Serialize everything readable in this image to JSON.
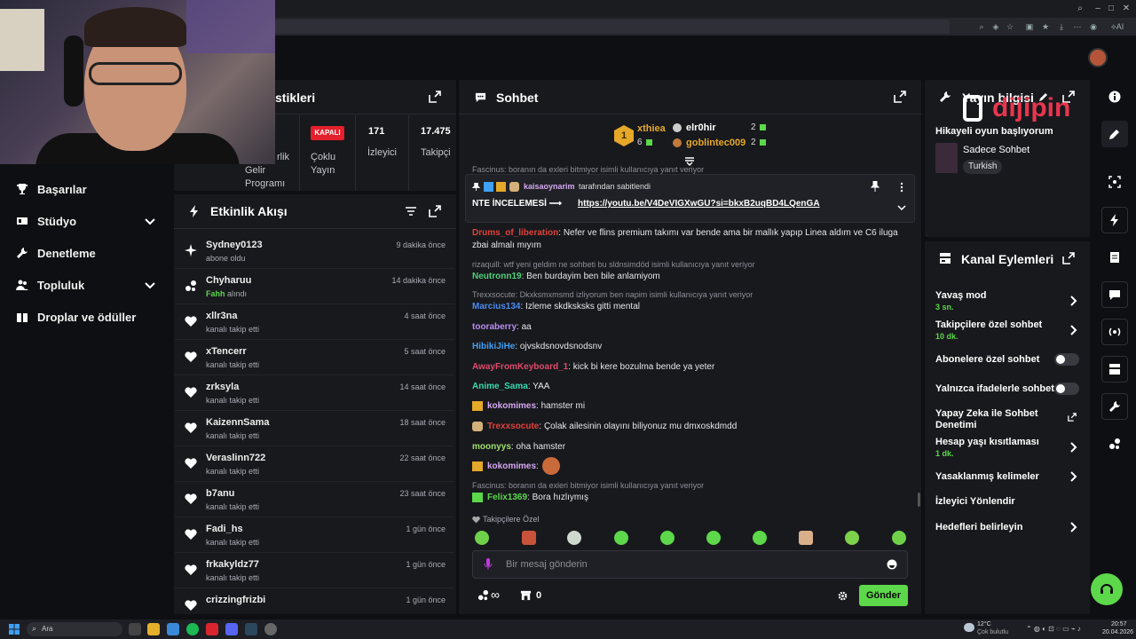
{
  "colors": {
    "accent": "#5cd84a",
    "live_off": "#e3202b",
    "link": "#ffffff"
  },
  "browser": {
    "search_placeholder": "Ara"
  },
  "nav": {
    "items": [
      {
        "label": "Başarılar",
        "icon": "trophy-icon"
      },
      {
        "label": "Stüdyo",
        "icon": "studio-icon",
        "expandable": true
      },
      {
        "label": "Denetleme",
        "icon": "wrench-icon"
      },
      {
        "label": "Topluluk",
        "icon": "community-icon",
        "expandable": true
      },
      {
        "label": "Droplar ve ödüller",
        "icon": "gift-icon"
      }
    ]
  },
  "stats": {
    "title_fragment": "stikleri",
    "col1": "rlik",
    "col1b": "Gelir",
    "col1c": "Programı",
    "badge": "KAPALI",
    "col2a": "Çoklu",
    "col2b": "Yayın",
    "viewers_value": "171",
    "viewers_label": "İzleyici",
    "followers_value": "17.475",
    "followers_label": "Takipçi"
  },
  "feed": {
    "title": "Etkinlik Akışı",
    "rows": [
      {
        "name": "Sydney0123",
        "sub": "abone oldu",
        "time": "9 dakika önce",
        "icon": "sparkle-icon"
      },
      {
        "name": "Chyharuu",
        "sub_accent": "Fahh",
        "sub": "alındı",
        "time": "14 dakika önce",
        "icon": "points-icon"
      },
      {
        "name": "xllr3na",
        "sub": "kanalı takip etti",
        "time": "4 saat önce",
        "icon": "heart-icon"
      },
      {
        "name": "xTencerr",
        "sub": "kanalı takip etti",
        "time": "5 saat önce",
        "icon": "heart-icon"
      },
      {
        "name": "zrksyla",
        "sub": "kanalı takip etti",
        "time": "14 saat önce",
        "icon": "heart-icon"
      },
      {
        "name": "KaizennSama",
        "sub": "kanalı takip etti",
        "time": "18 saat önce",
        "icon": "heart-icon"
      },
      {
        "name": "Veraslinn722",
        "sub": "kanalı takip etti",
        "time": "22 saat önce",
        "icon": "heart-icon"
      },
      {
        "name": "b7anu",
        "sub": "kanalı takip etti",
        "time": "23 saat önce",
        "icon": "heart-icon"
      },
      {
        "name": "Fadi_hs",
        "sub": "kanalı takip etti",
        "time": "1 gün önce",
        "icon": "heart-icon"
      },
      {
        "name": "frkakyldz77",
        "sub": "kanalı takip etti",
        "time": "1 gün önce",
        "icon": "heart-icon"
      },
      {
        "name": "crizzingfrizbi",
        "sub": "kanalı takip etti",
        "time": "1 gün önce",
        "icon": "heart-icon"
      }
    ]
  },
  "chat": {
    "title": "Sohbet",
    "leader1": {
      "rank": "1",
      "name": "xthiea",
      "count": "6"
    },
    "leader2": {
      "name": "elr0hir",
      "count": "2"
    },
    "leader3": {
      "name": "goblintec009",
      "count": "2"
    },
    "pinned": {
      "pinned_by": "kaisaoynarim",
      "pinned_suffix": "tarafından sabitlendi",
      "text_prefix": "NTE İNCELEMESİ ⟶",
      "link": "https://youtu.be/V4DeVIGXwGU?si=bkxB2uqBD4LQenGA"
    },
    "messages": [
      {
        "user": "Drums_of_liberation",
        "color": "#e0413a",
        "text": "Nefer ve flins premium takımı var bende ama bir mallık yapıp Linea aldım ve C6 iluga zbai almalı mıyım"
      },
      {
        "reply": "rizaquill: wtf yeni geldim ne sohbeti bu sldnsimdöd isimli kullanıcıya yanıt veriyor"
      },
      {
        "user": "Neutronn19",
        "color": "#4fd17a",
        "text": "Ben burdayim ben bile anlamiyom"
      },
      {
        "reply": "Trexxsocute: Dkxksmxmsmd izliyorum ben napim isimli kullanıcıya yanıt veriyor"
      },
      {
        "user": "Marcius134",
        "color": "#4a8cf0",
        "text": "Izleme skdksksks gitti mental"
      },
      {
        "user": "tooraberry",
        "color": "#b88df0",
        "text": "aa"
      },
      {
        "user": "HibikiJiHe",
        "color": "#3fa0f5",
        "text": "ojvskdsnovdsnodsnv"
      },
      {
        "user": "AwayFromKeyboard_1",
        "color": "#e04b6a",
        "text": "kick bi kere bozulma bende ya yeter"
      },
      {
        "user": "Anime_Sama",
        "color": "#38d9b0",
        "text": "YAA"
      },
      {
        "user": "kokomimes",
        "color": "#d4a8f0",
        "text": "hamster mi"
      },
      {
        "user": "Trexxsocute",
        "color": "#e0413a",
        "text": "Çolak ailesinin olayını biliyonuz mu dmxoskdmdd"
      },
      {
        "user": "moonyys",
        "color": "#9fe06a",
        "text": "oha hamster"
      },
      {
        "user": "kokomimes",
        "color": "#d4a8f0",
        "text": ""
      },
      {
        "reply": "Fascinus: boranın da exleri bitmiyor isimli kullanıcıya yanıt veriyor"
      },
      {
        "user": "Felix1369",
        "color": "#5cd84a",
        "text": "Bora hızlıymış"
      }
    ],
    "top_reply": "Fascinus: boranın da exleri bitmiyor isimli kullanıcıya yanıt veriyor",
    "followers_only": "Takipçilere Özel",
    "input_placeholder": "Bir mesaj gönderin",
    "points": "∞",
    "gifts": "0",
    "send": "Gönder"
  },
  "stream_info": {
    "title": "Yayın bilgisi",
    "stream_title": "Hikayeli oyun başlıyorum",
    "category": "Sadece Sohbet",
    "tag": "Turkish",
    "watermark": "dijipin"
  },
  "actions": {
    "title": "Kanal Eylemleri",
    "items": [
      {
        "label": "Yavaş mod",
        "sub": "3 sn.",
        "control": "chevron"
      },
      {
        "label": "Takipçilere özel sohbet",
        "sub": "10 dk.",
        "control": "chevron"
      },
      {
        "label": "Abonelere özel sohbet",
        "control": "toggle"
      },
      {
        "label": "Yalnızca ifadelerle sohbet",
        "control": "toggle"
      },
      {
        "label": "Yapay Zeka ile Sohbet Denetimi",
        "control": "external"
      },
      {
        "label": "Hesap yaşı kısıtlaması",
        "sub": "1 dk.",
        "control": "chevron"
      },
      {
        "label": "Yasaklanmış kelimeler",
        "control": "chevron"
      },
      {
        "label": "İzleyici Yönlendir",
        "control": "none"
      },
      {
        "label": "Hedefleri belirleyin",
        "control": "chevron"
      }
    ]
  },
  "taskbar": {
    "search": "Ara",
    "weather_temp": "12°C",
    "weather_desc": "Çok bulutlu",
    "clock_time": "20:57",
    "clock_date": "20.04.2026"
  }
}
